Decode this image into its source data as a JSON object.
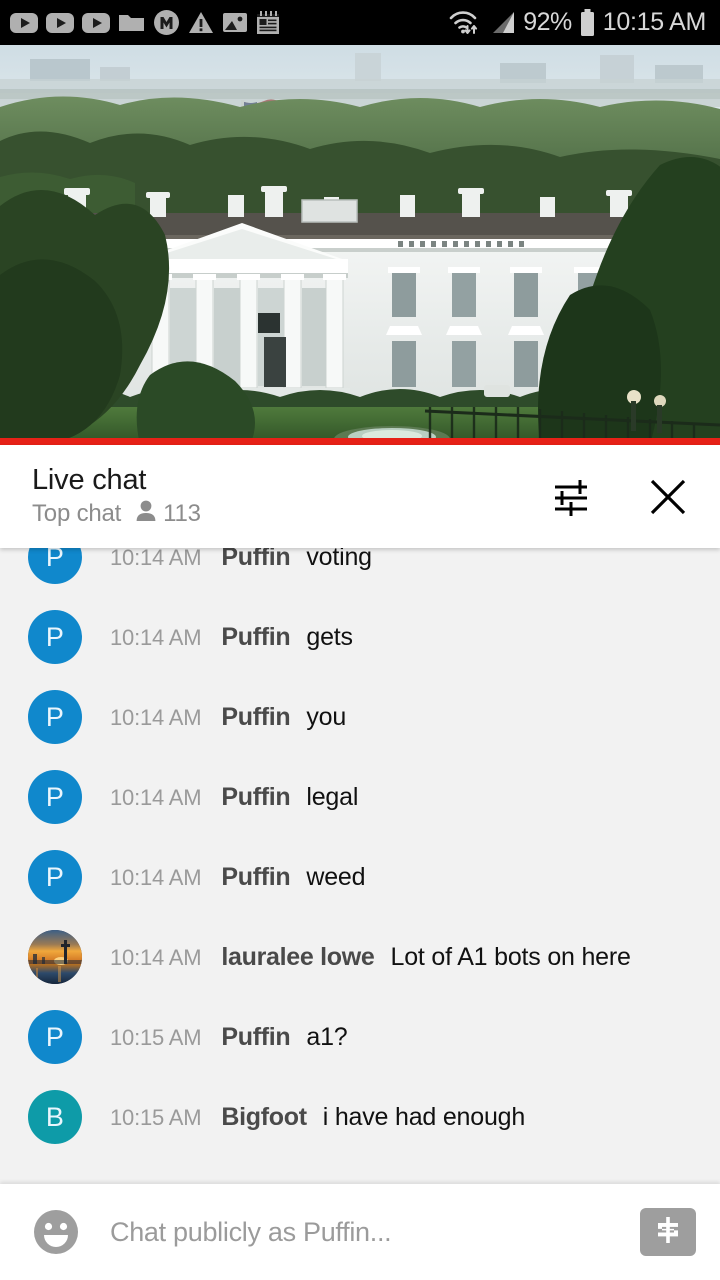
{
  "status_bar": {
    "icons": [
      "youtube-play-icon",
      "youtube-play-icon",
      "youtube-play-icon",
      "folder-icon",
      "m-circle-icon",
      "warning-triangle-icon",
      "image-icon",
      "notepad-icon"
    ],
    "wifi_icon": "wifi-transfer-icon",
    "signal_icon": "cellular-signal-icon",
    "battery_percent": "92%",
    "battery_icon": "battery-icon",
    "clock": "10:15 AM"
  },
  "video": {
    "description": "White House live stream",
    "progress_percent": 100,
    "progress_color": "#e62117"
  },
  "chat_header": {
    "title": "Live chat",
    "subtitle": "Top chat",
    "viewer_icon": "person-icon",
    "viewer_count": "113",
    "settings_icon": "tune-sliders-icon",
    "close_icon": "close-x-icon"
  },
  "messages": [
    {
      "time": "10:14 AM",
      "author": "Puffin",
      "text": "voting",
      "avatar_type": "initial",
      "initial": "P",
      "avatar_color": "#1088cc"
    },
    {
      "time": "10:14 AM",
      "author": "Puffin",
      "text": "gets",
      "avatar_type": "initial",
      "initial": "P",
      "avatar_color": "#1088cc"
    },
    {
      "time": "10:14 AM",
      "author": "Puffin",
      "text": "you",
      "avatar_type": "initial",
      "initial": "P",
      "avatar_color": "#1088cc"
    },
    {
      "time": "10:14 AM",
      "author": "Puffin",
      "text": "legal",
      "avatar_type": "initial",
      "initial": "P",
      "avatar_color": "#1088cc"
    },
    {
      "time": "10:14 AM",
      "author": "Puffin",
      "text": "weed",
      "avatar_type": "initial",
      "initial": "P",
      "avatar_color": "#1088cc"
    },
    {
      "time": "10:14 AM",
      "author": "lauralee lowe",
      "text": "Lot of A1 bots on here",
      "avatar_type": "photo",
      "initial": "",
      "avatar_color": "#3a2c22"
    },
    {
      "time": "10:15 AM",
      "author": "Puffin",
      "text": "a1?",
      "avatar_type": "initial",
      "initial": "P",
      "avatar_color": "#1088cc"
    },
    {
      "time": "10:15 AM",
      "author": "Bigfoot",
      "text": "i have had enough",
      "avatar_type": "initial",
      "initial": "B",
      "avatar_color": "#0e9ba8"
    }
  ],
  "input_bar": {
    "emoji_icon": "emoji-smiley-icon",
    "placeholder": "Chat publicly as Puffin...",
    "value": "",
    "superchat_icon": "dollar-sign-icon"
  }
}
